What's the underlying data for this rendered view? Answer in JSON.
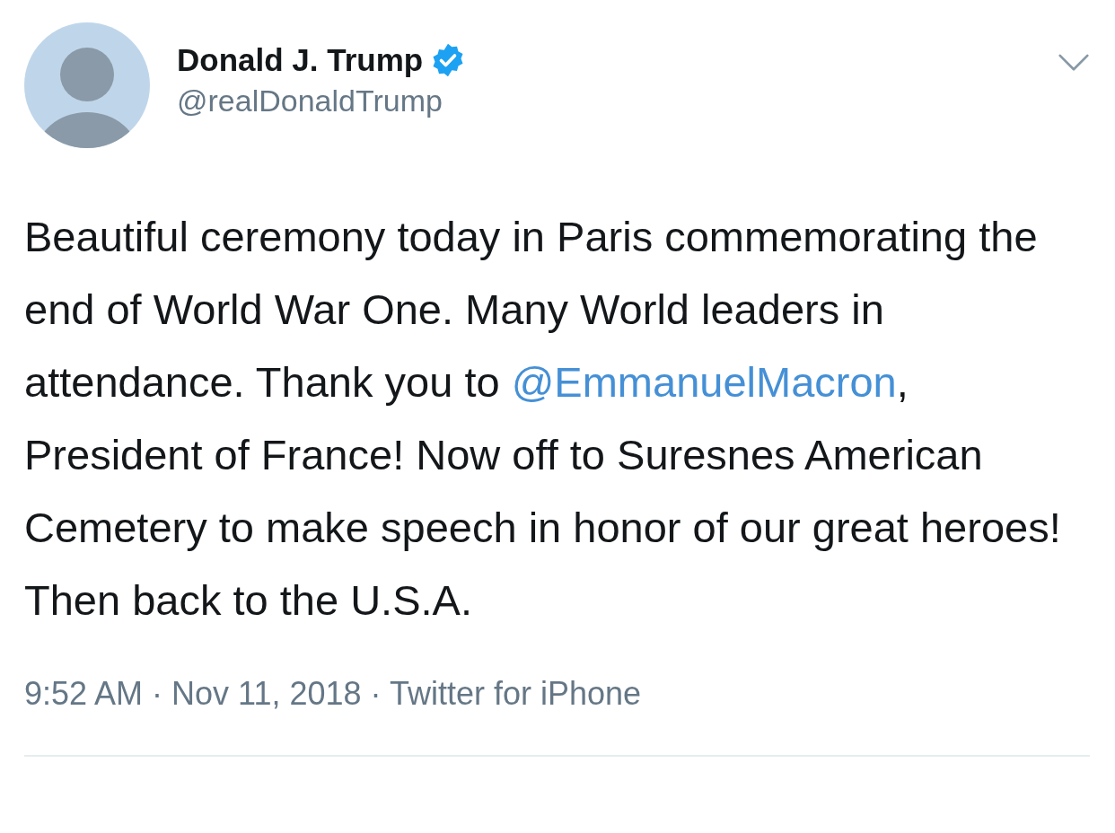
{
  "tweet": {
    "author": {
      "name": "Donald J. Trump",
      "verified": true,
      "handle": "@realDonaldTrump"
    },
    "text": [
      {
        "kind": "text",
        "text": "Beautiful ceremony today in Paris commemorating the end of World War One. Many World leaders in attendance. Thank you to "
      },
      {
        "kind": "mention",
        "text": "@EmmanuelMacron"
      },
      {
        "kind": "text",
        "text": ", President of France! Now off to Suresnes American Cemetery to make speech in honor of our great heroes! Then back to the U.S.A."
      }
    ],
    "meta": "9:52 AM · Nov 11, 2018 · Twitter for iPhone"
  }
}
